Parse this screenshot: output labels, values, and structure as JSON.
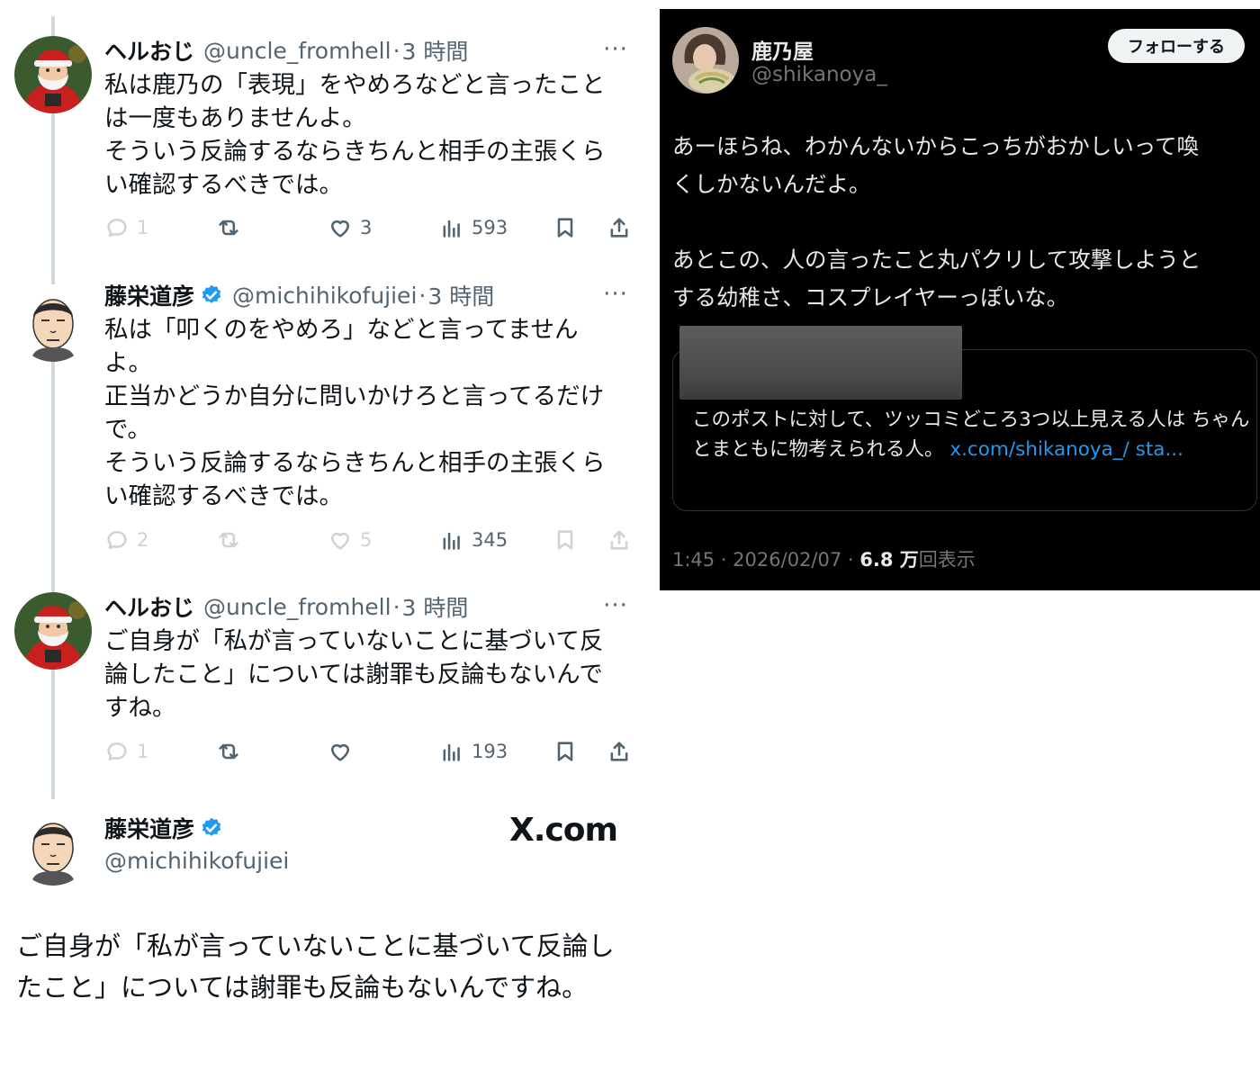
{
  "thread": [
    {
      "name": "ヘルおじ",
      "handle": "@uncle_fromhell",
      "time": "3 時間",
      "text": "私は鹿乃の「表現」をやめろなどと言ったこと\nは一度もありませんよ。\nそういう反論するならきちんと相手の主張くら\nい確認するべきでは。",
      "replies": "1",
      "retweets": "",
      "likes": "3",
      "views": "593",
      "avatar": "santa-avatar"
    },
    {
      "name": "藤栄道彦",
      "handle": "@michihikofujiei",
      "time": "3 時間",
      "text": "私は「叩くのをやめろ」などと言ってません\nよ。\n正当かどうか自分に問いかけろと言ってるだけ\nで。\nそういう反論するならきちんと相手の主張くら\nい確認するべきでは。",
      "replies": "2",
      "retweets": "",
      "likes": "5",
      "views": "345",
      "avatar": "cartoon-man-avatar"
    },
    {
      "name": "ヘルおじ",
      "handle": "@uncle_fromhell",
      "time": "3 時間",
      "text": "ご自身が「私が言っていないことに基づいて反\n論したこと」については謝罪も反論もないんで\nすね。",
      "replies": "1",
      "retweets": "",
      "likes": "",
      "views": "193",
      "avatar": "santa-avatar"
    }
  ],
  "card": {
    "name": "藤栄道彦",
    "handle": "@michihikofujiei",
    "logo": "X.com",
    "text": "ご自身が「私が言っていないことに基づいて反論したこと」については謝罪も反論もないんですね。"
  },
  "dark_post": {
    "name": "鹿乃屋",
    "handle": "@shikanoya_",
    "follow_label": "フォローする",
    "text": "あーほらね、わかんないからこっちがおかしいって喚\nくしかないんだよ。\n\nあとこの、人の言ったこと丸パクリして攻撃しようと\nする幼稚さ、コスプレイヤーっぽいな。",
    "quote_text": "このポストに対して、ツッコミどころ3つ以上見える人は ちゃんとまともに物考えられる人。",
    "quote_link": "x.com/shikanoya_/ sta...",
    "meta_time": "1:45 · 2026/02/07 · ",
    "meta_views": "6.8 万",
    "meta_views_suffix": "回表示"
  },
  "colors": {
    "text": "#0f1419",
    "muted": "#536471",
    "verified": "#1d9bf0",
    "link": "#1d9bf0",
    "dark_bg": "#000000"
  }
}
